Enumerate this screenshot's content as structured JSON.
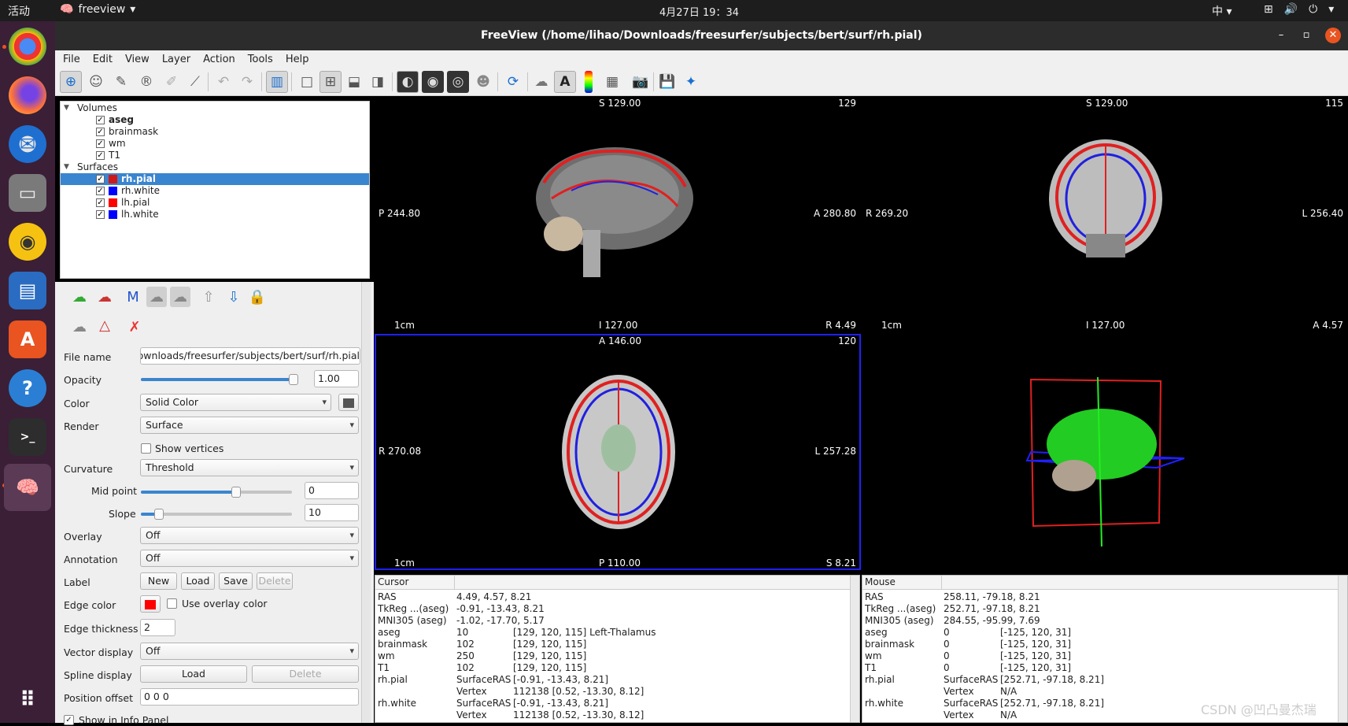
{
  "system": {
    "activities": "活动",
    "app_name": "freeview",
    "clock": "4月27日  19：34",
    "ime": "中"
  },
  "window": {
    "title": "FreeView (/home/lihao/Downloads/freesurfer/subjects/bert/surf/rh.pial)"
  },
  "menu": [
    "File",
    "Edit",
    "View",
    "Layer",
    "Action",
    "Tools",
    "Help"
  ],
  "tree": {
    "volumes_label": "Volumes",
    "volumes": [
      {
        "name": "aseg",
        "checked": true,
        "bold": true
      },
      {
        "name": "brainmask",
        "checked": true
      },
      {
        "name": "wm",
        "checked": true
      },
      {
        "name": "T1",
        "checked": true
      }
    ],
    "surfaces_label": "Surfaces",
    "surfaces": [
      {
        "name": "rh.pial",
        "checked": true,
        "color": "#d01818",
        "selected": true
      },
      {
        "name": "rh.white",
        "checked": true,
        "color": "#0000ff"
      },
      {
        "name": "lh.pial",
        "checked": true,
        "color": "#ff0000"
      },
      {
        "name": "lh.white",
        "checked": true,
        "color": "#0000ff"
      }
    ]
  },
  "panel": {
    "file_name_label": "File name",
    "file_name": "Downloads/freesurfer/subjects/bert/surf/rh.pial",
    "opacity_label": "Opacity",
    "opacity_value": "1.00",
    "opacity_fraction": 1.0,
    "color_label": "Color",
    "color_mode": "Solid Color",
    "render_label": "Render",
    "render_mode": "Surface",
    "show_vertices_label": "Show vertices",
    "curvature_label": "Curvature",
    "curvature_mode": "Threshold",
    "midpoint_label": "Mid point",
    "midpoint_value": "0",
    "midpoint_fraction": 0.63,
    "slope_label": "Slope",
    "slope_value": "10",
    "slope_fraction": 0.12,
    "overlay_label": "Overlay",
    "overlay_value": "Off",
    "annotation_label": "Annotation",
    "annotation_value": "Off",
    "label_label": "Label",
    "label_buttons": [
      "New",
      "Load",
      "Save",
      "Delete"
    ],
    "edge_color_label": "Edge color",
    "edge_color": "#ff0000",
    "use_overlay_color_label": "Use overlay color",
    "edge_thickness_label": "Edge thickness",
    "edge_thickness": "2",
    "vector_display_label": "Vector display",
    "vector_display_value": "Off",
    "spline_display_label": "Spline display",
    "spline_load": "Load",
    "spline_delete": "Delete",
    "position_offset_label": "Position offset",
    "position_offset": "0 0 0",
    "show_in_info_label": "Show in Info Panel"
  },
  "views": {
    "sagittal": {
      "top": "S 129.00",
      "slice": "129",
      "left": "P 244.80",
      "right": "A 280.80",
      "scale": "1cm",
      "bottom": "I 127.00",
      "corner": "R 4.49"
    },
    "coronal": {
      "top": "S 129.00",
      "slice": "115",
      "left": "R 269.20",
      "right": "L 256.40",
      "scale": "1cm",
      "bottom": "I 127.00",
      "corner": "A 4.57"
    },
    "axial": {
      "top": "A 146.00",
      "slice": "120",
      "left": "R 270.08",
      "right": "L 257.28",
      "scale": "1cm",
      "bottom": "P 110.00",
      "corner": "S 8.21"
    }
  },
  "cursor_info": {
    "header": "Cursor",
    "rows": [
      [
        "RAS",
        "4.49, 4.57, 8.21"
      ],
      [
        "TkReg ...(aseg)",
        "-0.91, -13.43, 8.21"
      ],
      [
        "MNI305 (aseg)",
        "-1.02, -17.70, 5.17"
      ],
      [
        "aseg",
        "10",
        "[129, 120, 115]  Left-Thalamus"
      ],
      [
        "brainmask",
        "102",
        "[129, 120, 115]"
      ],
      [
        "wm",
        "250",
        "[129, 120, 115]"
      ],
      [
        "T1",
        "102",
        "[129, 120, 115]"
      ],
      [
        "rh.pial",
        "SurfaceRAS",
        "[-0.91, -13.43, 8.21]"
      ],
      [
        "",
        "Vertex",
        "112138  [0.52, -13.30, 8.12]"
      ],
      [
        "rh.white",
        "SurfaceRAS",
        "[-0.91, -13.43, 8.21]"
      ],
      [
        "",
        "Vertex",
        "112138  [0.52, -13.30, 8.12]"
      ]
    ]
  },
  "mouse_info": {
    "header": "Mouse",
    "rows": [
      [
        "RAS",
        "258.11, -79.18, 8.21"
      ],
      [
        "TkReg ...(aseg)",
        "252.71, -97.18, 8.21"
      ],
      [
        "MNI305 (aseg)",
        "284.55, -95.99, 7.69"
      ],
      [
        "aseg",
        "0",
        "[-125, 120, 31]"
      ],
      [
        "brainmask",
        "0",
        "[-125, 120, 31]"
      ],
      [
        "wm",
        "0",
        "[-125, 120, 31]"
      ],
      [
        "T1",
        "0",
        "[-125, 120, 31]"
      ],
      [
        "rh.pial",
        "SurfaceRAS",
        "[252.71, -97.18, 8.21]"
      ],
      [
        "",
        "Vertex",
        "N/A"
      ],
      [
        "rh.white",
        "SurfaceRAS",
        "[252.71, -97.18, 8.21]"
      ],
      [
        "",
        "Vertex",
        "N/A"
      ]
    ]
  },
  "watermark": "CSDN @凹凸曼杰瑞"
}
